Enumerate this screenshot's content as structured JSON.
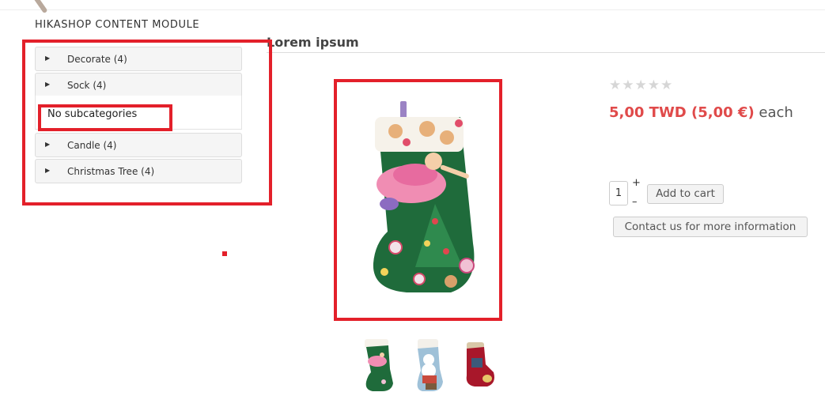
{
  "module": {
    "title": "HIKASHOP CONTENT MODULE"
  },
  "product": {
    "title": "Lorem ipsum",
    "rating": {
      "value": 0,
      "max": 5
    },
    "price_amount": "5,00 TWD (5,00 €)",
    "price_unit": " each",
    "quantity": "1",
    "qty_plus": "+",
    "qty_minus": "–",
    "add_to_cart_label": "Add to cart",
    "contact_label": "Contact us for more information",
    "thumbnails": [
      "stocking-fairy",
      "stocking-snowman",
      "stocking-red"
    ]
  },
  "categories": {
    "items": [
      {
        "label": "Decorate (4)"
      },
      {
        "label": "Sock (4)"
      },
      {
        "label": "Candle (4)"
      },
      {
        "label": "Christmas Tree (4)"
      }
    ],
    "no_subcategories": "No subcategories"
  },
  "colors": {
    "accent_red": "#e3202a",
    "price": "#e04a4a",
    "star_empty": "#d6d6d6"
  }
}
